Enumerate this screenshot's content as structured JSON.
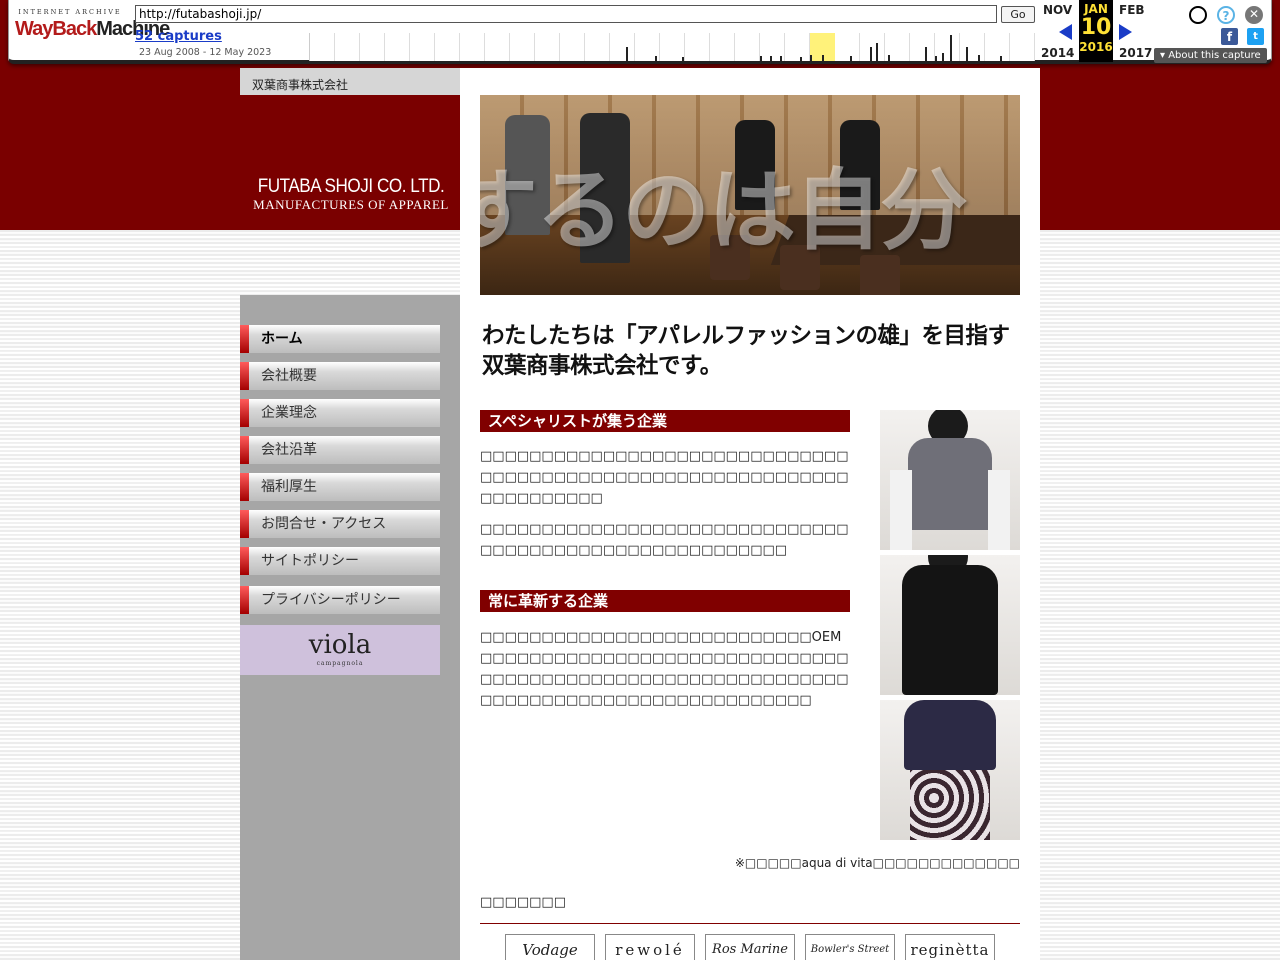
{
  "wayback": {
    "logo_top": "INTERNET ARCHIVE",
    "logo_way": "WayBack",
    "logo_machine": "Machine",
    "url": "http://futabashoji.jp/",
    "go_label": "Go",
    "captures": "52 captures",
    "range": "23 Aug 2008 - 12 May 2023",
    "prev_month": "NOV",
    "prev_year": "2014",
    "cur_month": "JAN",
    "cur_day": "10",
    "cur_year": "2016",
    "next_month": "FEB",
    "next_year": "2017",
    "about": "About this capture",
    "colors": {
      "accent": "#1a3cc7",
      "highlight": "#ffe135"
    }
  },
  "site": {
    "company_small": "双葉商事株式会社",
    "logo_line1": "FUTABA SHOJI CO. LTD.",
    "logo_line2": "MANUFACTURES OF APPAREL",
    "colors": {
      "brand": "#7a0000",
      "section": "#800000",
      "nav_accent": "#c31515"
    }
  },
  "nav": {
    "items": [
      {
        "label": "ホーム",
        "active": true
      },
      {
        "label": "会社概要"
      },
      {
        "label": "企業理念"
      },
      {
        "label": "会社沿革"
      },
      {
        "label": "福利厚生"
      },
      {
        "label": "お問合せ・アクセス"
      },
      {
        "label": "サイトポリシー"
      },
      {
        "label": "プライバシーポリシー"
      }
    ],
    "viola_title": "viola",
    "viola_sub": "campagnola"
  },
  "main": {
    "hero_overlay": "するのは自分",
    "headline_1": "わたしたちは「アパレルファッションの雄」を目指す",
    "headline_2": "双葉商事株式会社です。",
    "section1_title": "スペシャリストが集う企業",
    "section1_para1": "□□□□□□□□□□□□□□□□□□□□□□□□□□□□□□□□□□□□□□□□□□□□□□□□□□□□□□□□□□□□□□□□□□□□□□",
    "section1_para2": "□□□□□□□□□□□□□□□□□□□□□□□□□□□□□□□□□□□□□□□□□□□□□□□□□□□□□□□",
    "section2_title": "常に革新する企業",
    "section2_para1": "□□□□□□□□□□□□□□□□□□□□□□□□□□□OEM□□□□□□□□□□□□□□□□□□□□□□□□□□□□□□□□□□□□□□□□□□□□□□□□□□□□□□□□□□□□□□□□□□□□□□□□□□□□□□□□□□□□□□□",
    "caption": "※□□□□□aqua di vita□□□□□□□□□□□□□",
    "brands_title": "□□□□□□□",
    "brands": [
      "Vodage",
      "rewolé",
      "Ros Marine",
      "Bowler's Street",
      "reginètta"
    ]
  }
}
